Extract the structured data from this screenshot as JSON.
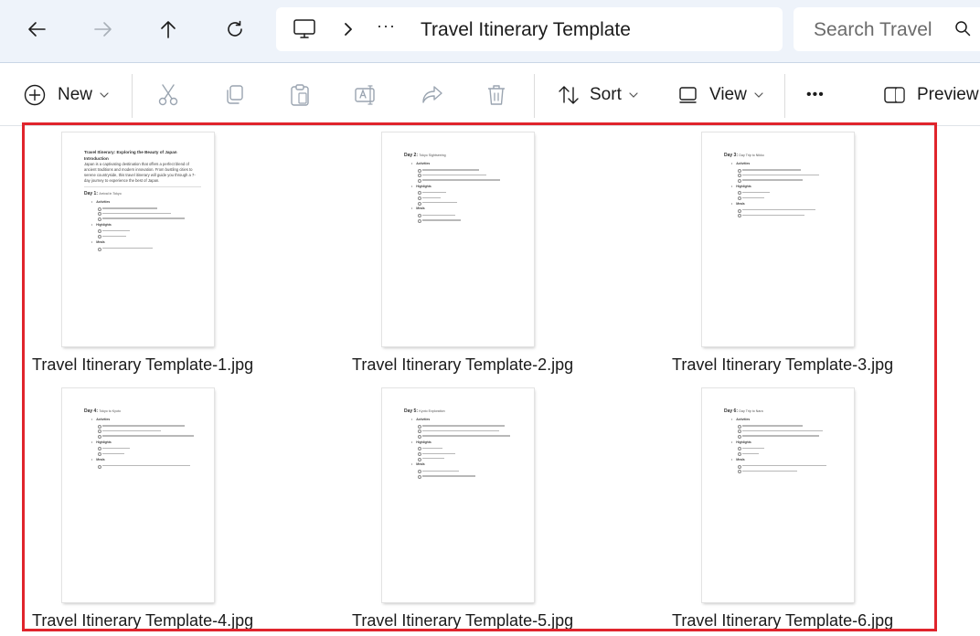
{
  "address_bar": {
    "crumb_overflow": "···",
    "current_folder": "Travel Itinerary Template",
    "search_placeholder": "Search Travel"
  },
  "command_bar": {
    "new_label": "New",
    "sort_label": "Sort",
    "view_label": "View",
    "more_label": "•••",
    "preview_label": "Preview"
  },
  "files": [
    {
      "name": "Travel Itinerary Template-1.jpg",
      "page": "intro",
      "day_title": "Day 1:",
      "day_sub": "Arrival in Tokyo"
    },
    {
      "name": "Travel Itinerary Template-2.jpg",
      "page": "day",
      "day_title": "Day 2:",
      "day_sub": "Tokyo Sightseeing"
    },
    {
      "name": "Travel Itinerary Template-3.jpg",
      "page": "day",
      "day_title": "Day 3:",
      "day_sub": "Day Trip to Nikko"
    },
    {
      "name": "Travel Itinerary Template-4.jpg",
      "page": "day",
      "day_title": "Day 4:",
      "day_sub": "Tokyo to Kyoto"
    },
    {
      "name": "Travel Itinerary Template-5.jpg",
      "page": "day",
      "day_title": "Day 5:",
      "day_sub": "Kyoto Exploration"
    },
    {
      "name": "Travel Itinerary Template-6.jpg",
      "page": "day",
      "day_title": "Day 6:",
      "day_sub": "Day Trip to Nara"
    }
  ],
  "intro_page": {
    "title": "Travel Itinerary: Exploring the Beauty of Japan",
    "heading": "Introduction",
    "body": "Japan is a captivating destination that offers a perfect blend of ancient traditions and modern innovation. From bustling cities to serene countryside, this travel itinerary will guide you through a 7-day journey to experience the best of Japan."
  },
  "page_sections": {
    "activities": "Activities",
    "highlights": "Highlights",
    "meals": "Meals"
  },
  "colors": {
    "selection_outline": "#e0242c",
    "topbar_bg": "#eef3fa"
  }
}
